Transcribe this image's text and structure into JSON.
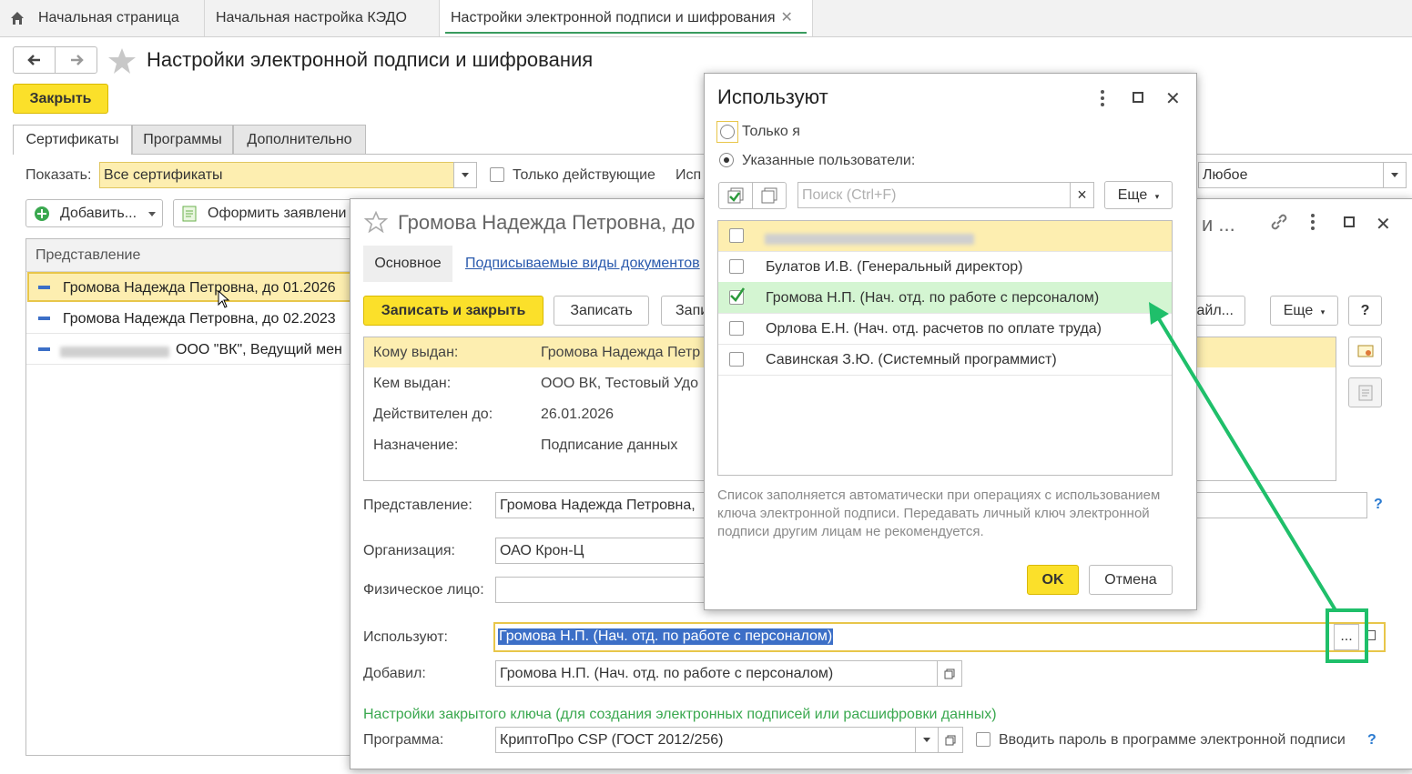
{
  "tabs": [
    {
      "label": "Начальная страница"
    },
    {
      "label": "Начальная настройка КЭДО"
    },
    {
      "label": "Настройки электронной подписи и шифрования"
    }
  ],
  "page": {
    "title": "Настройки электронной подписи и шифрования",
    "close_label": "Закрыть",
    "subtabs": [
      "Сертификаты",
      "Программы",
      "Дополнительно"
    ],
    "show_label": "Показать:",
    "show_value": "Все сертификаты",
    "only_active_label": "Только действующие",
    "usage_label_partial": "Исп",
    "usage_value": "Любое",
    "add_label": "Добавить...",
    "apply_label": "Оформить заявлени",
    "list_header": "Представление",
    "rows": [
      {
        "text": "Громова Надежда Петровна, до 01.2026"
      },
      {
        "text": "Громова Надежда Петровна, до 02.2023"
      },
      {
        "text": "ООО \"ВК\", Ведущий мен"
      }
    ]
  },
  "cert_window": {
    "title": "Громова Надежда Петровна, до",
    "title_tail": "и ...",
    "tab_main": "Основное",
    "tab_link": "Подписываемые виды документов",
    "save_close": "Записать и закрыть",
    "save": "Записать",
    "save_partial": "Запи",
    "files_partial": "айл...",
    "more": "Еще",
    "help": "?",
    "info": [
      {
        "label": "Кому выдан:",
        "value": "Громова Надежда Петр"
      },
      {
        "label": "Кем выдан:",
        "value": "ООО ВК, Тестовый Удо"
      },
      {
        "label": "Действителен до:",
        "value": "26.01.2026"
      },
      {
        "label": "Назначение:",
        "value": "Подписание данных"
      }
    ],
    "repr_label": "Представление:",
    "repr_value": "Громова Надежда Петровна,",
    "org_label": "Организация:",
    "org_value": "ОАО Крон-Ц",
    "person_label": "Физическое лицо:",
    "person_value": "",
    "users_label": "Используют:",
    "users_value": "Громова Н.П. (Нач. отд. по работе с персоналом)",
    "users_ellipsis": "...",
    "added_label": "Добавил:",
    "added_value": "Громова Н.П. (Нач. отд. по работе с персоналом)",
    "key_section": "Настройки закрытого ключа (для создания электронных подписей или расшифровки данных)",
    "program_label": "Программа:",
    "program_value": "КриптоПро CSP (ГОСТ 2012/256)",
    "enter_pwd_label": "Вводить пароль в программе электронной подписи",
    "q": "?"
  },
  "dialog": {
    "title": "Используют",
    "radio_only_me": "Только я",
    "radio_users": "Указанные пользователи:",
    "search_placeholder": "Поиск (Ctrl+F)",
    "clear": "×",
    "more": "Еще",
    "users": [
      {
        "name": "",
        "checked": false,
        "blurred": true
      },
      {
        "name": "Булатов И.В. (Генеральный директор)",
        "checked": false
      },
      {
        "name": "Громова Н.П. (Нач. отд. по работе с персоналом)",
        "checked": true
      },
      {
        "name": "Орлова Е.Н. (Нач. отд. расчетов по оплате труда)",
        "checked": false
      },
      {
        "name": "Савинская З.Ю. (Системный программист)",
        "checked": false
      }
    ],
    "note": "Список заполняется автоматически при операциях с использованием ключа электронной подписи. Передавать личный ключ электронной подписи другим лицам не рекомендуется.",
    "ok": "OK",
    "cancel": "Отмена"
  },
  "colors": {
    "accent_green": "#1fbf6a",
    "yellow": "#fbe02a",
    "selected_row": "#fdeeb0"
  }
}
